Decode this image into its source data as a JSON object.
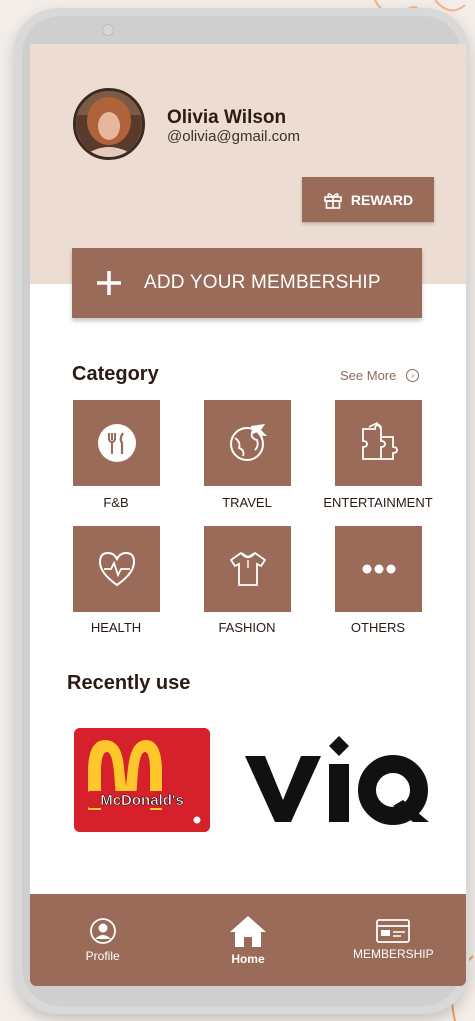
{
  "profile": {
    "name": "Olivia Wilson",
    "email": "@olivia@gmail.com"
  },
  "actions": {
    "reward_label": "REWARD",
    "add_membership_label": "ADD YOUR MEMBERSHIP"
  },
  "category": {
    "title": "Category",
    "see_more": "See More",
    "items": [
      {
        "label": "F&B",
        "icon": "food-plate-icon"
      },
      {
        "label": "TRAVEL",
        "icon": "globe-plane-icon"
      },
      {
        "label": "ENTERTAINMENT",
        "icon": "puzzle-icon"
      },
      {
        "label": "HEALTH",
        "icon": "heart-pulse-icon"
      },
      {
        "label": "FASHION",
        "icon": "shirt-icon"
      },
      {
        "label": "OTHERS",
        "icon": "more-dots-icon"
      }
    ]
  },
  "recent": {
    "title": "Recently use",
    "brands": [
      "McDonald's",
      "VIQ"
    ]
  },
  "nav": {
    "items": [
      {
        "label": "Profile",
        "icon": "profile-icon"
      },
      {
        "label": "Home",
        "icon": "home-icon"
      },
      {
        "label": "MEMBERSHIP",
        "icon": "membership-card-icon"
      }
    ]
  },
  "colors": {
    "accent": "#9b6b59",
    "header_bg": "#ecdcd2",
    "text_dark": "#2b1b14"
  }
}
